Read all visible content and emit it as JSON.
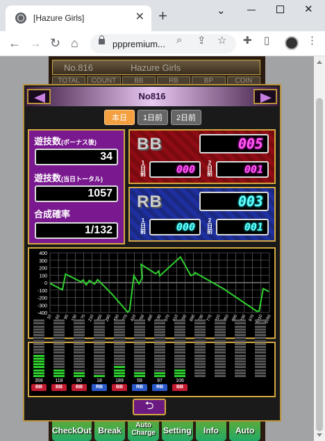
{
  "browser": {
    "tab_title": "[Hazure Girls]",
    "tab_close": "✕",
    "new_tab": "+",
    "minimize": "⌄",
    "url": "pppremium...",
    "nav_back": "←",
    "nav_forward": "→",
    "reload": "↻",
    "home": "⌂"
  },
  "background_page": {
    "machine_no": "No.816",
    "machine_name": "Hazure Girls",
    "columns": [
      "TOTAL",
      "COUNT",
      "BB",
      "RB",
      "BP",
      "COIN"
    ],
    "bottom_buttons": [
      "CheckOut",
      "Break",
      "Auto Charge",
      "Setting",
      "Info",
      "Auto"
    ]
  },
  "modal": {
    "title": "No816",
    "tabs": [
      "本日",
      "1日前",
      "2日前"
    ],
    "active_tab": 0,
    "stats": {
      "games_after_bonus_label": "遊技数",
      "games_after_bonus_sub": "(ボーナス後)",
      "games_after_bonus": "34",
      "games_total_label": "遊技数",
      "games_total_sub": "(当日トータル)",
      "games_total": "1057",
      "combined_prob_label": "合成確率",
      "combined_prob": "1/132"
    },
    "bb": {
      "label": "BB",
      "today": "005",
      "day1_label": "1日前",
      "day1": "000",
      "day2_label": "2日前",
      "day2": "001",
      "color": "#ff5cf0"
    },
    "rb": {
      "label": "RB",
      "today": "003",
      "day1_label": "1日前",
      "day1": "000",
      "day2_label": "2日前",
      "day2": "001",
      "color": "#66ffff"
    },
    "back_icon": "⮌"
  },
  "chart_data": {
    "type": "line",
    "ylim": [
      -400,
      400
    ],
    "y_ticks": [
      400,
      300,
      200,
      100,
      0,
      -100,
      -200,
      -300,
      -400
    ],
    "x_ticks": [
      "10",
      "50",
      "90",
      "130",
      "170",
      "210",
      "250",
      "290",
      "330",
      "370",
      "410",
      "450",
      "490",
      "530",
      "570",
      "610",
      "650",
      "690",
      "730",
      "770",
      "810",
      "850",
      "890",
      "930",
      "970",
      "1010",
      "1050"
    ],
    "xlim": [
      0,
      1060
    ],
    "line_color": "#2ed12e",
    "x": [
      0,
      60,
      75,
      150,
      160,
      175,
      190,
      215,
      230,
      300,
      375,
      385,
      405,
      430,
      445,
      440,
      510,
      525,
      530,
      630,
      680,
      700,
      700,
      840,
      1000,
      1010,
      1030,
      1057
    ],
    "y": [
      -10,
      -95,
      115,
      10,
      35,
      -30,
      30,
      -20,
      40,
      -155,
      -395,
      -370,
      95,
      -15,
      60,
      245,
      120,
      155,
      90,
      345,
      95,
      120,
      135,
      -85,
      -385,
      -380,
      -80,
      -120
    ]
  },
  "bonus_history": [
    {
      "games": "356",
      "type": "BB",
      "level": 0.4
    },
    {
      "games": "118",
      "type": "BB",
      "level": 0.15
    },
    {
      "games": "80",
      "type": "BB",
      "level": 0.1
    },
    {
      "games": "18",
      "type": "RB",
      "level": 0.05
    },
    {
      "games": "189",
      "type": "BB",
      "level": 0.2
    },
    {
      "games": "59",
      "type": "RB",
      "level": 0.08
    },
    {
      "games": "97",
      "type": "RB",
      "level": 0.12
    },
    {
      "games": "106",
      "type": "BB",
      "level": 0.13
    },
    {
      "games": "",
      "type": "",
      "level": 0
    },
    {
      "games": "",
      "type": "",
      "level": 0
    },
    {
      "games": "",
      "type": "",
      "level": 0
    },
    {
      "games": "",
      "type": "",
      "level": 0
    }
  ]
}
